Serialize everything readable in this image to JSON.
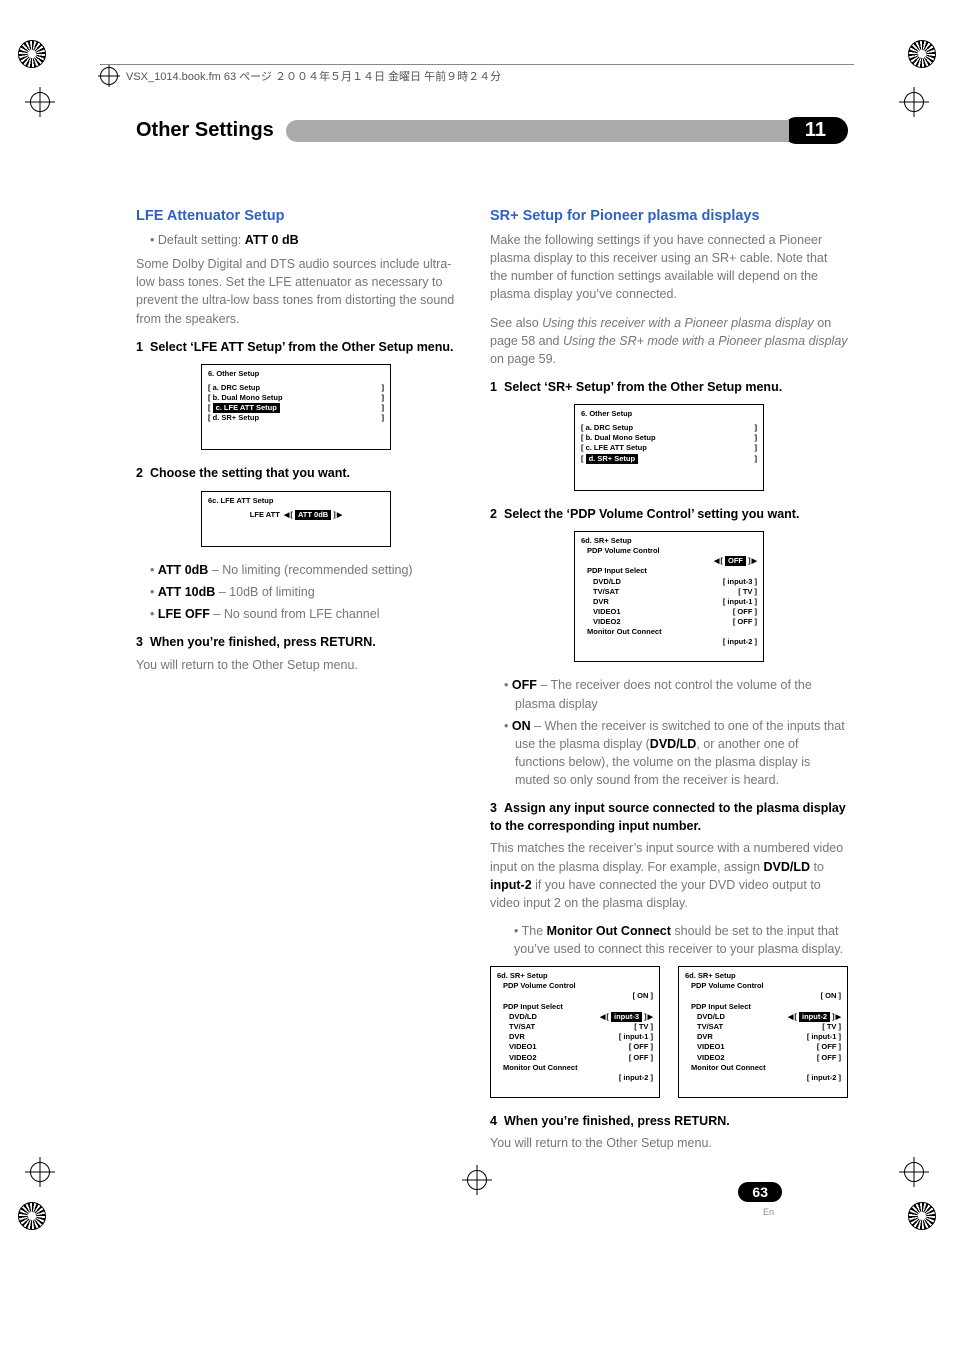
{
  "header_meta": "VSX_1014.book.fm 63 ページ ２００４年５月１４日 金曜日 午前９時２４分",
  "chapter": {
    "title": "Other Settings",
    "number": "11"
  },
  "left": {
    "h": "LFE Attenuator Setup",
    "default": "Default setting: ",
    "default_val": "ATT 0 dB",
    "intro": "Some Dolby Digital and DTS audio sources include ultra-low bass tones. Set the LFE attenuator as necessary to prevent the ultra-low bass tones from distorting the sound from the speakers.",
    "step1": "Select ‘LFE ATT Setup’ from the Other Setup menu.",
    "osd1": {
      "title": "6. Other Setup",
      "a": "a. DRC Setup",
      "b": "b. Dual Mono Setup",
      "c": "c. LFE ATT Setup",
      "d": "d. SR+ Setup"
    },
    "step2": "Choose the setting that you want.",
    "osd2": {
      "title": "6c. LFE ATT Setup",
      "label": "LFE ATT",
      "value": "ATT 0dB"
    },
    "opts": {
      "a_b": "ATT 0dB",
      "a_t": " – No limiting (recommended setting)",
      "b_b": "ATT 10dB",
      "b_t": " – 10dB of limiting",
      "c_b": "LFE OFF",
      "c_t": " – No sound from LFE channel"
    },
    "step3": "When you’re finished, press RETURN.",
    "after3": "You will return to the Other Setup menu."
  },
  "right": {
    "h": "SR+ Setup for Pioneer plasma displays",
    "intro": "Make the following settings if you have connected a Pioneer plasma display to this receiver using an SR+ cable. Note that the number of function settings available will depend on the plasma display you’ve connected.",
    "see1a": "See also ",
    "see1b": "Using this receiver with a Pioneer plasma display",
    "see1c": " on page 58 and ",
    "see1d": "Using the SR+ mode with a Pioneer plasma display",
    "see1e": " on page 59.",
    "step1": "Select ‘SR+ Setup’ from the Other Setup menu.",
    "osd1": {
      "title": "6. Other Setup",
      "a": "a. DRC Setup",
      "b": "b. Dual Mono Setup",
      "c": "c. LFE ATT Setup",
      "d": "d. SR+ Setup"
    },
    "step2": "Select the ‘PDP Volume Control’ setting you want.",
    "osd2": {
      "title": "6d. SR+ Setup",
      "l1": "PDP Volume Control",
      "v1": "OFF",
      "l2": "PDP Input Select",
      "r_dvd": "DVD/LD",
      "v_dvd": "input-3",
      "r_tv": "TV/SAT",
      "v_tv": "TV",
      "r_dvr": "DVR",
      "v_dvr": "input-1",
      "r_v1": "VIDEO1",
      "v_v1": "OFF",
      "r_v2": "VIDEO2",
      "v_v2": "OFF",
      "l3": "Monitor Out Connect",
      "v3": "input-2"
    },
    "opt_off_b": "OFF",
    "opt_off_t": " – The receiver does not control the volume of the plasma display",
    "opt_on_b": "ON",
    "opt_on_t1": " – When the receiver is switched to one of the inputs that use the plasma display (",
    "opt_on_t2": "DVD/LD",
    "opt_on_t3": ", or another one of functions below), the volume on the plasma display is muted so only sound from the receiver is heard.",
    "step3": "Assign any input source connected to the plasma display to the corresponding input number.",
    "after3a": "This matches the receiver’s input source with a numbered video input on the plasma display. For example, assign ",
    "after3b": "DVD/LD",
    "after3c": " to ",
    "after3d": "input-2",
    "after3e": " if you have connected the your DVD video output to video input 2 on the plasma display.",
    "moc1": "The ",
    "moc2": "Monitor Out Connect",
    "moc3": " should be set to the input that you’ve used to connect this receiver to your plasma display.",
    "osd3": {
      "title": "6d. SR+ Setup",
      "l1": "PDP Volume Control",
      "v1": "ON",
      "l2": "PDP Input Select",
      "r_dvd": "DVD/LD",
      "v_dvd": "input-3",
      "r_tv": "TV/SAT",
      "v_tv": "TV",
      "r_dvr": "DVR",
      "v_dvr": "input-1",
      "r_v1": "VIDEO1",
      "v_v1": "OFF",
      "r_v2": "VIDEO2",
      "v_v2": "OFF",
      "l3": "Monitor Out Connect",
      "v3": "input-2",
      "hl": "input-2"
    },
    "step4": "When you’re finished, press RETURN.",
    "after4": "You will return to the Other Setup menu."
  },
  "footer": {
    "page": "63",
    "lang": "En"
  }
}
